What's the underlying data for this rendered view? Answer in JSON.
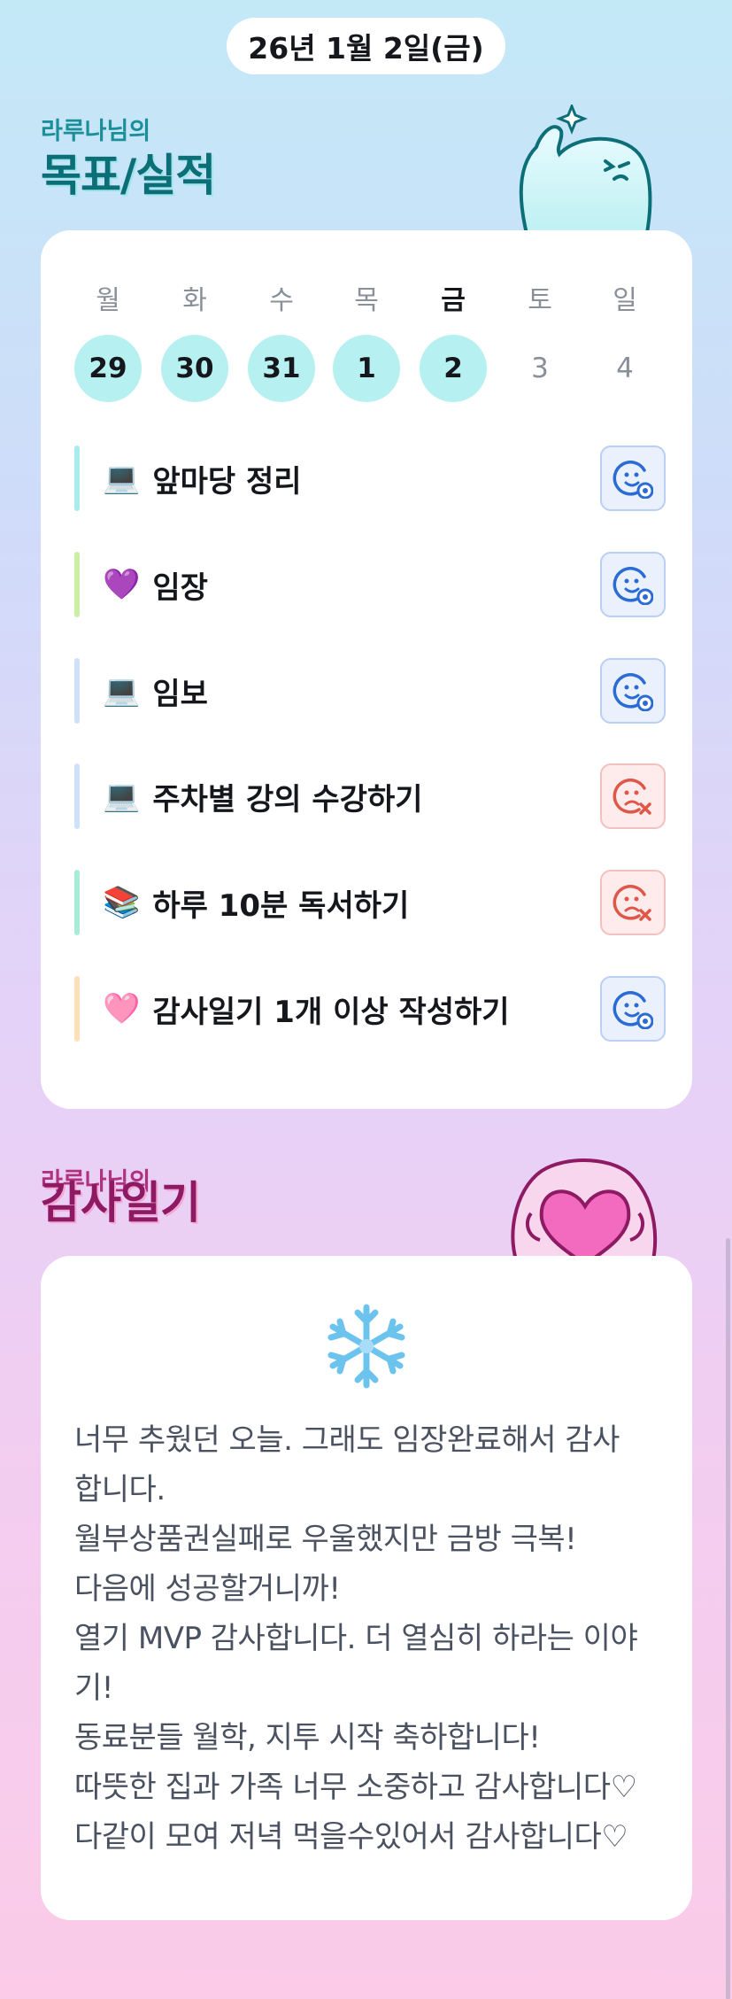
{
  "header": {
    "date": "26년 1월 2일(금)"
  },
  "goals_section": {
    "subtitle": "라루나님의",
    "title": "목표/실적"
  },
  "week": {
    "days": [
      {
        "label": "월",
        "num": "29",
        "state": "done"
      },
      {
        "label": "화",
        "num": "30",
        "state": "done"
      },
      {
        "label": "수",
        "num": "31",
        "state": "done"
      },
      {
        "label": "목",
        "num": "1",
        "state": "done"
      },
      {
        "label": "금",
        "num": "2",
        "state": "done",
        "today": true
      },
      {
        "label": "토",
        "num": "3",
        "state": "empty"
      },
      {
        "label": "일",
        "num": "4",
        "state": "empty"
      }
    ]
  },
  "goals": [
    {
      "emoji": "💻",
      "text": "앞마당 정리",
      "bar_color": "#a8ecee",
      "status": "success",
      "status_icon": "smile-check-icon"
    },
    {
      "emoji": "💜",
      "text": "임장",
      "bar_color": "#c9f0a5",
      "status": "success",
      "status_icon": "smile-check-icon"
    },
    {
      "emoji": "💻",
      "text": "임보",
      "bar_color": "#cfe0fa",
      "status": "success",
      "status_icon": "smile-check-icon"
    },
    {
      "emoji": "💻",
      "text": "주차별 강의 수강하기",
      "bar_color": "#cfe0fa",
      "status": "fail",
      "status_icon": "sad-x-icon"
    },
    {
      "emoji": "📚",
      "text": "하루 10분 독서하기",
      "bar_color": "#a8ecd8",
      "status": "fail",
      "status_icon": "sad-x-icon"
    },
    {
      "emoji": "🩷",
      "text": "감사일기 1개 이상 작성하기",
      "bar_color": "#fde0b8",
      "status": "success",
      "status_icon": "smile-check-icon"
    }
  ],
  "gratitude_section": {
    "subtitle": "라루나님의",
    "title": "감사일기"
  },
  "gratitude": {
    "icon": "snowflake-icon",
    "lines": [
      "너무 추웠던 오늘. 그래도 임장완료해서 감사",
      "합니다.",
      "월부상품권실패로 우울했지만 금방 극복!",
      "다음에 성공할거니까!",
      "열기 MVP 감사합니다. 더 열심히 하라는 이야",
      "기!",
      "동료분들 월학, 지투 시작 축하합니다!",
      "따뜻한 집과 가족 너무 소중하고 감사합니다♡",
      "다같이 모여 저녁 먹을수있어서 감사합니다♡"
    ]
  },
  "colors": {
    "day_done": "#b7f0f0",
    "success_icon": "#2a6bd6",
    "fail_icon": "#e0574a",
    "goal_title": "#0c6f78",
    "gratitude_title": "#8d1a62"
  }
}
